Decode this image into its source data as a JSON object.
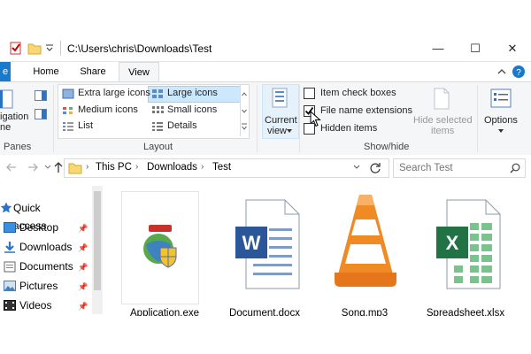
{
  "window": {
    "title": "C:\\Users\\chris\\Downloads\\Test",
    "controls": {
      "minimize": "—",
      "maximize": "☐",
      "close": "✕"
    }
  },
  "ribbon_tabs": {
    "file": "e",
    "home": "Home",
    "share": "Share",
    "view": "View"
  },
  "ribbon": {
    "panes": {
      "nav_pane_line1": "igation",
      "nav_pane_line2": "ne",
      "group_label": "Panes"
    },
    "layout": {
      "extra_large": "Extra large icons",
      "large": "Large icons",
      "medium": "Medium icons",
      "small": "Small icons",
      "list": "List",
      "details": "Details",
      "group_label": "Layout"
    },
    "current_view": {
      "line1": "Current",
      "line2": "view"
    },
    "show_hide": {
      "item_check_boxes": "Item check boxes",
      "file_name_extensions": "File name extensions",
      "hidden_items": "Hidden items",
      "hide_selected_line1": "Hide selected",
      "hide_selected_line2": "items",
      "group_label": "Show/hide",
      "checks": {
        "item_check_boxes": false,
        "file_name_extensions": true,
        "hidden_items": false
      }
    },
    "options": {
      "label": "Options"
    }
  },
  "address": {
    "crumbs": [
      "This PC",
      "Downloads",
      "Test"
    ],
    "separator": "›"
  },
  "search": {
    "placeholder": "Search Test"
  },
  "nav_pane": {
    "quick_access": "Quick access",
    "items": [
      "Desktop",
      "Downloads",
      "Documents",
      "Pictures",
      "Videos"
    ]
  },
  "files": [
    {
      "name": "Application.exe",
      "icon": "application-icon"
    },
    {
      "name": "Document.docx",
      "icon": "word-document-icon"
    },
    {
      "name": "Song.mp3",
      "icon": "vlc-cone-icon"
    },
    {
      "name": "Spreadsheet.xlsx",
      "icon": "excel-spreadsheet-icon"
    }
  ],
  "colors": {
    "accent": "#1979ca",
    "selected": "#cce8ff",
    "selected_border": "#99d1ff",
    "word": "#2b579a",
    "excel": "#217346",
    "vlc": "#f08a24"
  }
}
